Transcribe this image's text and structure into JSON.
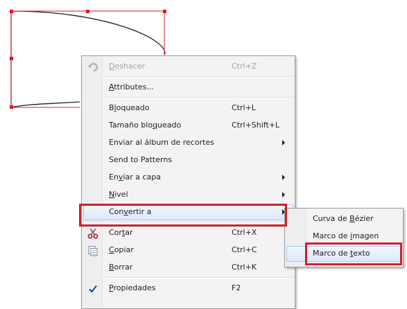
{
  "colors": {
    "menu_bg": "#f3f3f3",
    "highlight": "#dce9fb",
    "selection_handle": "#e8141b",
    "callout_frame": "#d0202c",
    "check": "#1c3f94"
  },
  "context_menu": {
    "items": [
      {
        "label": "Deshacer",
        "mnemonic": "D",
        "shortcut": "Ctrl+Z",
        "icon": "undo-icon",
        "disabled": true
      },
      {
        "separator": true
      },
      {
        "label": "Attributes...",
        "mnemonic": "A"
      },
      {
        "separator": true
      },
      {
        "label": "Bloqueado",
        "mnemonic": "l",
        "shortcut": "Ctrl+L"
      },
      {
        "label": "Tamaño bloqueado",
        "mnemonic": "q",
        "shortcut": "Ctrl+Shift+L"
      },
      {
        "label": "Enviar al álbum de recortes",
        "submenu": true
      },
      {
        "label": "Send to Patterns"
      },
      {
        "label": "Enviar a capa",
        "mnemonic": "v",
        "submenu": true
      },
      {
        "label": "Nivel",
        "mnemonic": "N",
        "submenu": true
      },
      {
        "label": "Convertir a",
        "mnemonic": "v",
        "submenu": true,
        "highlighted": true
      },
      {
        "separator": true
      },
      {
        "label": "Cortar",
        "mnemonic": "t",
        "shortcut": "Ctrl+X",
        "icon": "scissors-icon"
      },
      {
        "label": "Copiar",
        "mnemonic": "C",
        "shortcut": "Ctrl+C",
        "icon": "copy-icon"
      },
      {
        "label": "Borrar",
        "mnemonic": "B",
        "shortcut": "Ctrl+K"
      },
      {
        "separator": true
      },
      {
        "label": "Propiedades",
        "mnemonic": "P",
        "shortcut": "F2",
        "icon": "checkmark-icon",
        "checked": true
      }
    ]
  },
  "submenu": {
    "items": [
      {
        "label": "Curva de Bézier",
        "mnemonic": "B"
      },
      {
        "label": "Marco de imagen",
        "mnemonic": "i"
      },
      {
        "label": "Marco de texto",
        "mnemonic": "t",
        "highlighted": true
      }
    ]
  }
}
